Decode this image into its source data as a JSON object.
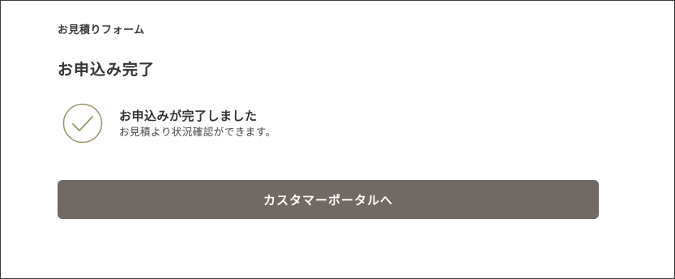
{
  "header": {
    "form_label": "お見積りフォーム"
  },
  "main": {
    "title": "お申込み完了",
    "status": {
      "icon": "check-circle-icon",
      "heading": "お申込みが完了しました",
      "description": "お見積より状況確認ができます。"
    },
    "portal_button_label": "カスタマーポータルへ"
  },
  "colors": {
    "accent_check": "#9a9468",
    "button_bg": "#716a64",
    "text": "#333333"
  }
}
